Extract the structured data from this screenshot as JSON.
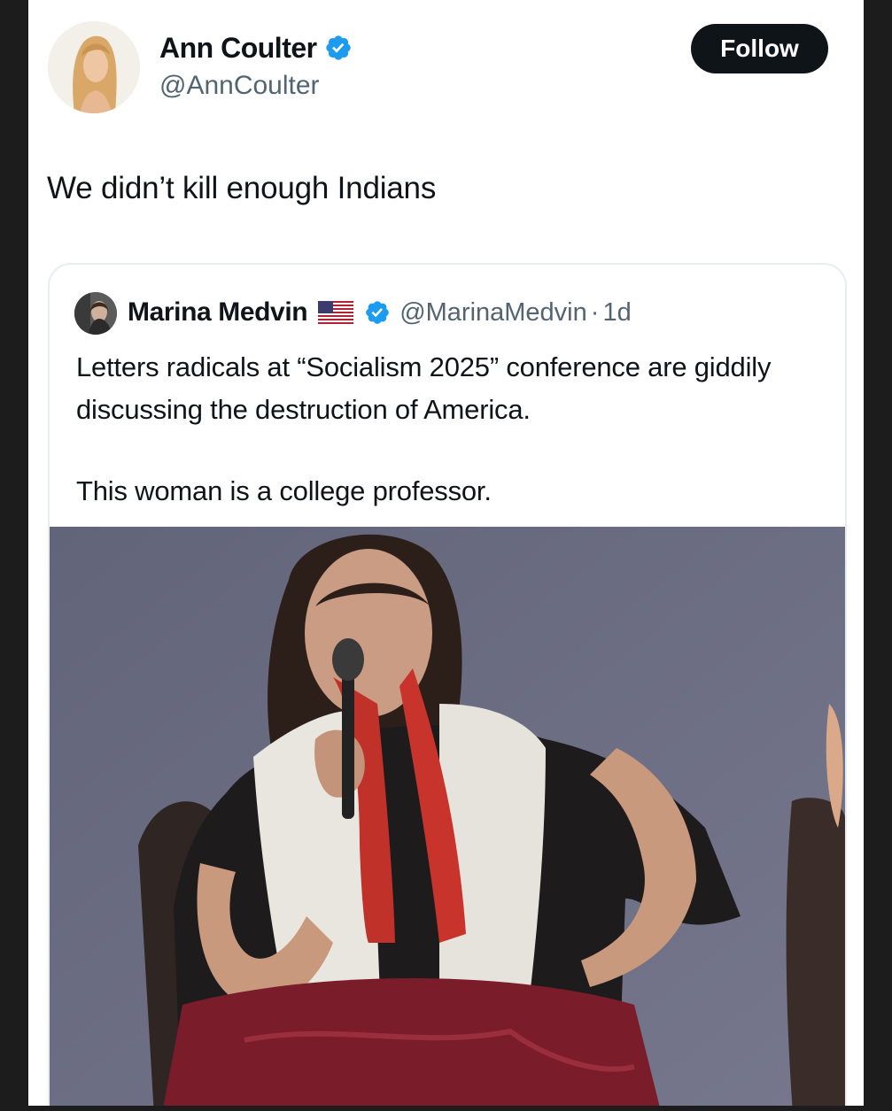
{
  "tweet": {
    "author": {
      "display_name": "Ann Coulter",
      "handle": "@AnnCoulter",
      "verified_icon": "verified-badge-icon"
    },
    "follow_label": "Follow",
    "text": "We didn’t kill enough Indians"
  },
  "quoted_tweet": {
    "author": {
      "display_name": "Marina Medvin",
      "flag_icon": "us-flag-icon",
      "verified_icon": "verified-badge-icon",
      "handle": "@MarinaMedvin",
      "separator": "·",
      "time": "1d"
    },
    "text_paragraphs": [
      "Letters radicals at “Socialism 2025” conference are giddily discussing the destruction of America.",
      "This woman is a college professor."
    ],
    "media": "photo"
  },
  "colors": {
    "primary_text": "#0f1419",
    "secondary_text": "#536471",
    "verified_blue": "#1d9bf0",
    "follow_button_bg": "#0f1419",
    "border": "#e6ecf0",
    "frame": "#1c1c1c"
  }
}
